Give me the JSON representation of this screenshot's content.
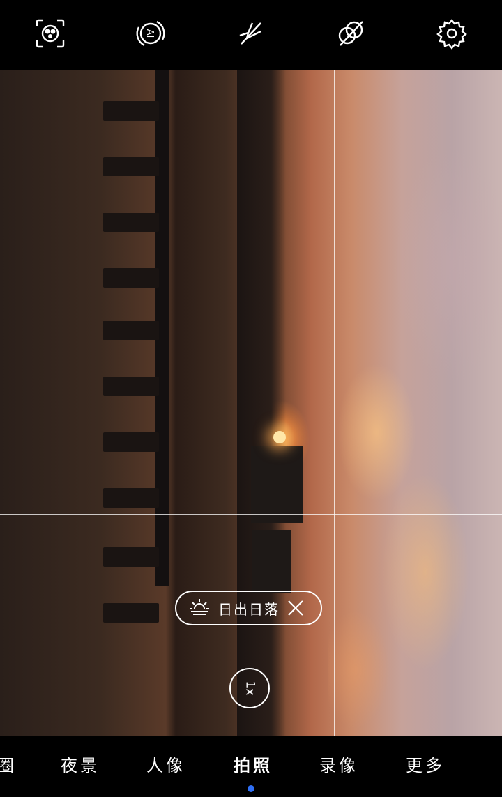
{
  "top_icons": [
    {
      "name": "ai-lens-icon"
    },
    {
      "name": "ai-master-icon"
    },
    {
      "name": "flash-off-icon"
    },
    {
      "name": "filter-off-icon"
    },
    {
      "name": "settings-gear-icon"
    }
  ],
  "scene": {
    "icon": "sunrise-icon",
    "label": "日出日落",
    "close_icon": "close-icon"
  },
  "zoom": {
    "label": "1x"
  },
  "modes": [
    {
      "label": "圈",
      "active": false
    },
    {
      "label": "夜景",
      "active": false
    },
    {
      "label": "人像",
      "active": false
    },
    {
      "label": "拍照",
      "active": true
    },
    {
      "label": "录像",
      "active": false
    },
    {
      "label": "更多",
      "active": false
    }
  ],
  "colors": {
    "active_indicator": "#2f6ff5",
    "foreground": "#ffffff",
    "bar_background": "#000000"
  }
}
